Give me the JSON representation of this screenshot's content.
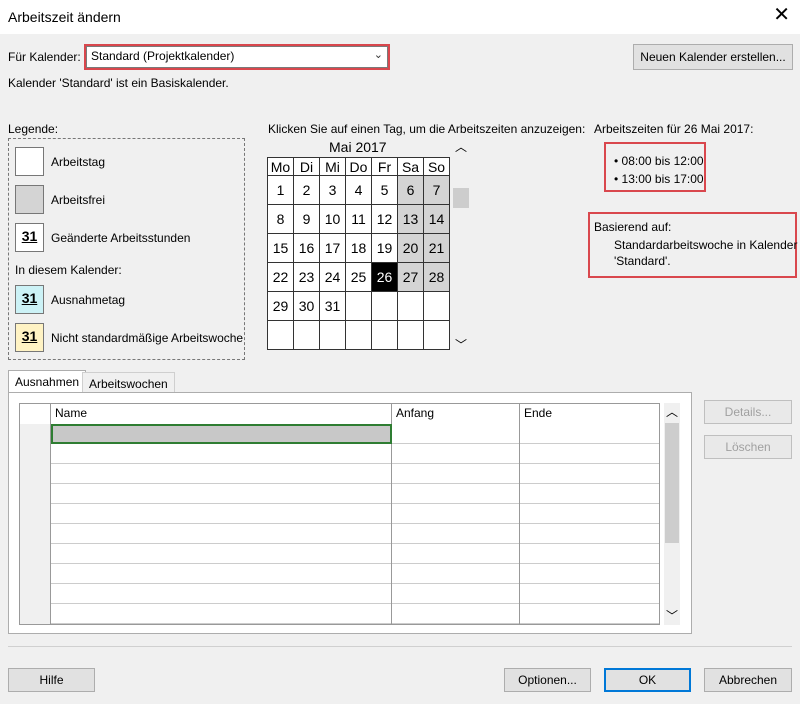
{
  "window": {
    "title": "Arbeitszeit ändern",
    "close_glyph": "✕"
  },
  "calendar_select": {
    "label": "Für Kalender:",
    "value": "Standard (Projektkalender)",
    "new_button": "Neuen Kalender erstellen...",
    "info": "Kalender 'Standard' ist ein Basiskalender."
  },
  "legend": {
    "title": "Legende:",
    "workday": "Arbeitstag",
    "nonwork": "Arbeitsfrei",
    "changed": "Geänderte Arbeitsstunden",
    "in_calendar": "In diesem Kalender:",
    "exception": "Ausnahmetag",
    "nonstandard": "Nicht standardmäßige Arbeitswoche",
    "day_number": "31"
  },
  "calendar": {
    "instruction": "Klicken Sie auf einen Tag, um die Arbeitszeiten anzuzeigen:",
    "month": "Mai 2017",
    "weekdays": [
      "Mo",
      "Di",
      "Mi",
      "Do",
      "Fr",
      "Sa",
      "So"
    ],
    "weeks": [
      [
        "1",
        "2",
        "3",
        "4",
        "5",
        "6",
        "7"
      ],
      [
        "8",
        "9",
        "10",
        "11",
        "12",
        "13",
        "14"
      ],
      [
        "15",
        "16",
        "17",
        "18",
        "19",
        "20",
        "21"
      ],
      [
        "22",
        "23",
        "24",
        "25",
        "26",
        "27",
        "28"
      ],
      [
        "29",
        "30",
        "31",
        "",
        "",
        "",
        ""
      ],
      [
        "",
        "",
        "",
        "",
        "",
        "",
        ""
      ]
    ],
    "selected_day": "26"
  },
  "work_times": {
    "title": "Arbeitszeiten für 26 Mai 2017:",
    "slots": [
      "• 08:00 bis 12:00",
      "• 13:00 bis 17:00"
    ],
    "based_on_label": "Basierend auf:",
    "based_on_line1": "Standardarbeitswoche in Kalender",
    "based_on_line2": "'Standard'."
  },
  "tabs": {
    "exceptions": "Ausnahmen",
    "work_weeks": "Arbeitswochen"
  },
  "grid": {
    "columns": [
      "Name",
      "Anfang",
      "Ende"
    ]
  },
  "side_buttons": {
    "details": "Details...",
    "delete": "Löschen"
  },
  "footer": {
    "help": "Hilfe",
    "options": "Optionen...",
    "ok": "OK",
    "cancel": "Abbrechen"
  },
  "colors": {
    "highlight_box": "#d9474d",
    "selected_cell_border": "#2e7d32",
    "default_button_border": "#0078d7"
  }
}
